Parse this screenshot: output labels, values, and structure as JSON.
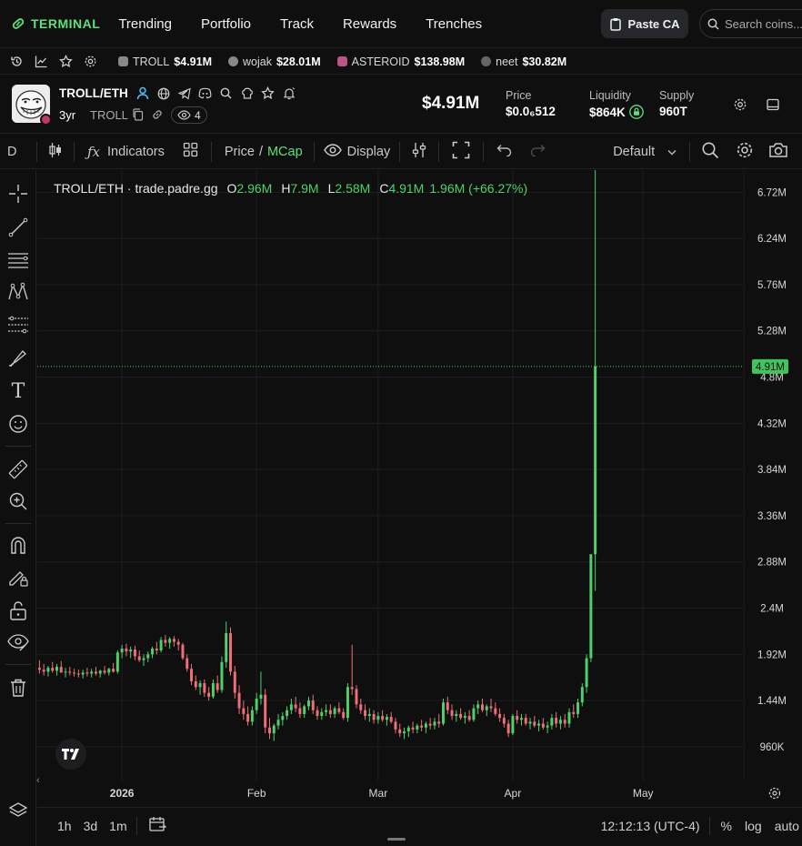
{
  "brand": {
    "name": "TERMINAL"
  },
  "nav": [
    "Trending",
    "Portfolio",
    "Track",
    "Rewards",
    "Trenches"
  ],
  "paste_ca": "Paste CA",
  "search": {
    "placeholder": "Search coins..."
  },
  "tickers": [
    {
      "name": "TROLL",
      "value": "$4.91M"
    },
    {
      "name": "wojak",
      "value": "$28.01M"
    },
    {
      "name": "ASTEROID",
      "value": "$138.98M"
    },
    {
      "name": "neet",
      "value": "$30.82M"
    }
  ],
  "token": {
    "pair": "TROLL/ETH",
    "age": "3yr",
    "symbol": "TROLL",
    "watchers": "4",
    "mcap": "$4.91M",
    "price_label": "Price",
    "price_value": "$0.0₆512",
    "liquidity_label": "Liquidity",
    "liquidity_value": "$864K",
    "supply_label": "Supply",
    "supply_value": "960T"
  },
  "toolbar": {
    "interval": "D",
    "indicators": "Indicators",
    "price": "Price",
    "slash": "/",
    "mcap": "MCap",
    "display": "Display",
    "layout": "Default"
  },
  "legend": {
    "title": "TROLL/ETH · trade.padre.gg",
    "o_label": "O",
    "o": "2.96M",
    "h_label": "H",
    "h": "7.9M",
    "l_label": "L",
    "l": "2.58M",
    "c_label": "C",
    "c": "4.91M",
    "change": "1.96M (+66.27%)"
  },
  "bottom": {
    "ranges": [
      "1h",
      "3d",
      "1m"
    ],
    "time": "12:12:13 (UTC-4)",
    "percent": "%",
    "log": "log",
    "auto": "auto"
  },
  "colors": {
    "up": "#4fd16a",
    "down": "#ef6e78",
    "accent": "#5ee07a"
  },
  "chart_data": {
    "type": "candlestick",
    "y_ticks": [
      "6.72M",
      "6.24M",
      "5.76M",
      "5.28M",
      "4.8M",
      "4.32M",
      "3.84M",
      "3.36M",
      "2.88M",
      "2.4M",
      "1.92M",
      "1.44M",
      "960K"
    ],
    "y_tick_values": [
      6.72,
      6.24,
      5.76,
      5.28,
      4.8,
      4.32,
      3.84,
      3.36,
      2.88,
      2.4,
      1.92,
      1.44,
      0.96
    ],
    "x_ticks": [
      "2026",
      "Feb",
      "Mar",
      "Apr",
      "May"
    ],
    "x_tick_days": [
      0,
      31,
      59,
      90,
      120
    ],
    "ylim": [
      0.6,
      6.95
    ],
    "xlim": [
      -19.5,
      143
    ],
    "last_price_label": "4.91M",
    "last_price": 4.91,
    "candles_millions": [
      [
        -19,
        1.78,
        1.86,
        1.72,
        1.76
      ],
      [
        -18,
        1.76,
        1.82,
        1.7,
        1.74
      ],
      [
        -17,
        1.74,
        1.8,
        1.69,
        1.78
      ],
      [
        -16,
        1.78,
        1.84,
        1.73,
        1.75
      ],
      [
        -15,
        1.75,
        1.82,
        1.7,
        1.79
      ],
      [
        -14,
        1.79,
        1.85,
        1.74,
        1.73
      ],
      [
        -13,
        1.73,
        1.78,
        1.68,
        1.74
      ],
      [
        -12,
        1.74,
        1.79,
        1.7,
        1.73
      ],
      [
        -11,
        1.73,
        1.77,
        1.69,
        1.72
      ],
      [
        -10,
        1.72,
        1.76,
        1.68,
        1.71
      ],
      [
        -9,
        1.71,
        1.76,
        1.67,
        1.73
      ],
      [
        -8,
        1.73,
        1.78,
        1.69,
        1.72
      ],
      [
        -7,
        1.72,
        1.77,
        1.68,
        1.74
      ],
      [
        -6,
        1.74,
        1.79,
        1.7,
        1.72
      ],
      [
        -5,
        1.72,
        1.76,
        1.68,
        1.75
      ],
      [
        -4,
        1.75,
        1.8,
        1.71,
        1.73
      ],
      [
        -3,
        1.73,
        1.78,
        1.7,
        1.77
      ],
      [
        -2,
        1.77,
        1.83,
        1.73,
        1.74
      ],
      [
        -1,
        1.74,
        1.96,
        1.72,
        1.94
      ],
      [
        0,
        1.94,
        2.02,
        1.88,
        1.98
      ],
      [
        1,
        1.98,
        2.03,
        1.9,
        1.95
      ],
      [
        2,
        1.95,
        2.0,
        1.88,
        1.97
      ],
      [
        3,
        1.97,
        2.01,
        1.86,
        1.9
      ],
      [
        4,
        1.9,
        1.96,
        1.84,
        1.86
      ],
      [
        5,
        1.86,
        1.92,
        1.8,
        1.88
      ],
      [
        6,
        1.88,
        1.95,
        1.84,
        1.92
      ],
      [
        7,
        1.92,
        2.0,
        1.88,
        1.98
      ],
      [
        8,
        1.98,
        2.05,
        1.92,
        1.96
      ],
      [
        9,
        1.96,
        2.1,
        1.94,
        2.07
      ],
      [
        10,
        2.07,
        2.12,
        2.0,
        2.04
      ],
      [
        11,
        2.04,
        2.1,
        1.98,
        2.08
      ],
      [
        12,
        2.08,
        2.11,
        2.0,
        2.05
      ],
      [
        13,
        2.05,
        2.08,
        1.96,
        2.02
      ],
      [
        14,
        2.02,
        2.04,
        1.86,
        1.88
      ],
      [
        15,
        1.88,
        1.92,
        1.74,
        1.77
      ],
      [
        16,
        1.77,
        1.82,
        1.6,
        1.64
      ],
      [
        17,
        1.64,
        1.7,
        1.55,
        1.58
      ],
      [
        18,
        1.58,
        1.65,
        1.5,
        1.62
      ],
      [
        19,
        1.62,
        1.66,
        1.48,
        1.52
      ],
      [
        20,
        1.52,
        1.58,
        1.44,
        1.48
      ],
      [
        21,
        1.48,
        1.66,
        1.46,
        1.62
      ],
      [
        22,
        1.62,
        1.7,
        1.52,
        1.55
      ],
      [
        23,
        1.55,
        1.9,
        1.52,
        1.84
      ],
      [
        24,
        1.84,
        2.26,
        1.78,
        2.14
      ],
      [
        25,
        2.14,
        2.2,
        1.7,
        1.74
      ],
      [
        26,
        1.74,
        1.8,
        1.46,
        1.52
      ],
      [
        27,
        1.52,
        1.6,
        1.3,
        1.36
      ],
      [
        28,
        1.36,
        1.44,
        1.24,
        1.3
      ],
      [
        29,
        1.3,
        1.38,
        1.18,
        1.22
      ],
      [
        30,
        1.22,
        1.38,
        1.18,
        1.34
      ],
      [
        31,
        1.34,
        1.52,
        1.3,
        1.46
      ],
      [
        32,
        1.46,
        1.74,
        1.4,
        1.5
      ],
      [
        33,
        1.5,
        1.56,
        1.1,
        1.16
      ],
      [
        34,
        1.16,
        1.26,
        1.04,
        1.1
      ],
      [
        35,
        1.1,
        1.2,
        1.02,
        1.18
      ],
      [
        36,
        1.18,
        1.3,
        1.14,
        1.24
      ],
      [
        37,
        1.24,
        1.32,
        1.18,
        1.28
      ],
      [
        38,
        1.28,
        1.38,
        1.24,
        1.34
      ],
      [
        39,
        1.34,
        1.46,
        1.3,
        1.4
      ],
      [
        40,
        1.4,
        1.48,
        1.32,
        1.36
      ],
      [
        41,
        1.36,
        1.42,
        1.26,
        1.3
      ],
      [
        42,
        1.3,
        1.4,
        1.26,
        1.38
      ],
      [
        43,
        1.38,
        1.48,
        1.34,
        1.44
      ],
      [
        44,
        1.44,
        1.5,
        1.3,
        1.34
      ],
      [
        45,
        1.34,
        1.38,
        1.24,
        1.28
      ],
      [
        46,
        1.28,
        1.36,
        1.24,
        1.32
      ],
      [
        47,
        1.32,
        1.4,
        1.28,
        1.34
      ],
      [
        48,
        1.34,
        1.4,
        1.26,
        1.3
      ],
      [
        49,
        1.3,
        1.38,
        1.26,
        1.36
      ],
      [
        50,
        1.36,
        1.42,
        1.3,
        1.32
      ],
      [
        51,
        1.32,
        1.36,
        1.24,
        1.26
      ],
      [
        52,
        1.26,
        1.62,
        1.22,
        1.58
      ],
      [
        53,
        1.58,
        2.02,
        1.5,
        1.56
      ],
      [
        54,
        1.56,
        1.6,
        1.36,
        1.4
      ],
      [
        55,
        1.4,
        1.46,
        1.3,
        1.34
      ],
      [
        56,
        1.34,
        1.4,
        1.24,
        1.28
      ],
      [
        57,
        1.28,
        1.36,
        1.22,
        1.3
      ],
      [
        58,
        1.3,
        1.34,
        1.2,
        1.24
      ],
      [
        59,
        1.24,
        1.32,
        1.2,
        1.28
      ],
      [
        60,
        1.28,
        1.34,
        1.22,
        1.24
      ],
      [
        61,
        1.24,
        1.3,
        1.18,
        1.27
      ],
      [
        62,
        1.27,
        1.32,
        1.2,
        1.22
      ],
      [
        63,
        1.22,
        1.26,
        1.1,
        1.14
      ],
      [
        64,
        1.14,
        1.2,
        1.06,
        1.1
      ],
      [
        65,
        1.1,
        1.16,
        1.04,
        1.12
      ],
      [
        66,
        1.12,
        1.18,
        1.06,
        1.16
      ],
      [
        67,
        1.16,
        1.22,
        1.1,
        1.14
      ],
      [
        68,
        1.14,
        1.2,
        1.1,
        1.18
      ],
      [
        69,
        1.18,
        1.24,
        1.12,
        1.16
      ],
      [
        70,
        1.16,
        1.22,
        1.1,
        1.2
      ],
      [
        71,
        1.2,
        1.26,
        1.14,
        1.18
      ],
      [
        72,
        1.18,
        1.26,
        1.14,
        1.22
      ],
      [
        73,
        1.22,
        1.3,
        1.16,
        1.2
      ],
      [
        74,
        1.2,
        1.46,
        1.18,
        1.42
      ],
      [
        75,
        1.42,
        1.48,
        1.3,
        1.34
      ],
      [
        76,
        1.34,
        1.4,
        1.24,
        1.28
      ],
      [
        77,
        1.28,
        1.34,
        1.22,
        1.3
      ],
      [
        78,
        1.3,
        1.36,
        1.24,
        1.26
      ],
      [
        79,
        1.26,
        1.32,
        1.2,
        1.28
      ],
      [
        80,
        1.28,
        1.34,
        1.22,
        1.24
      ],
      [
        81,
        1.24,
        1.4,
        1.22,
        1.36
      ],
      [
        82,
        1.36,
        1.44,
        1.3,
        1.4
      ],
      [
        83,
        1.4,
        1.46,
        1.32,
        1.34
      ],
      [
        84,
        1.34,
        1.4,
        1.28,
        1.38
      ],
      [
        85,
        1.38,
        1.46,
        1.32,
        1.36
      ],
      [
        86,
        1.36,
        1.42,
        1.28,
        1.3
      ],
      [
        87,
        1.3,
        1.36,
        1.22,
        1.26
      ],
      [
        88,
        1.26,
        1.3,
        1.16,
        1.2
      ],
      [
        89,
        1.2,
        1.24,
        1.06,
        1.1
      ],
      [
        90,
        1.1,
        1.3,
        1.08,
        1.28
      ],
      [
        91,
        1.28,
        1.34,
        1.2,
        1.24
      ],
      [
        92,
        1.24,
        1.3,
        1.18,
        1.26
      ],
      [
        93,
        1.26,
        1.3,
        1.18,
        1.2
      ],
      [
        94,
        1.2,
        1.26,
        1.14,
        1.22
      ],
      [
        95,
        1.22,
        1.28,
        1.16,
        1.18
      ],
      [
        96,
        1.18,
        1.24,
        1.12,
        1.2
      ],
      [
        97,
        1.2,
        1.26,
        1.14,
        1.16
      ],
      [
        98,
        1.16,
        1.22,
        1.1,
        1.18
      ],
      [
        99,
        1.18,
        1.3,
        1.14,
        1.26
      ],
      [
        100,
        1.26,
        1.32,
        1.16,
        1.2
      ],
      [
        101,
        1.2,
        1.28,
        1.14,
        1.24
      ],
      [
        102,
        1.24,
        1.3,
        1.16,
        1.2
      ],
      [
        103,
        1.2,
        1.36,
        1.16,
        1.32
      ],
      [
        104,
        1.32,
        1.4,
        1.26,
        1.3
      ],
      [
        105,
        1.3,
        1.46,
        1.26,
        1.42
      ],
      [
        106,
        1.42,
        1.62,
        1.38,
        1.58
      ],
      [
        107,
        1.58,
        1.92,
        1.52,
        1.88
      ],
      [
        108,
        1.88,
        2.96,
        1.84,
        2.96
      ],
      [
        109,
        2.96,
        7.9,
        2.58,
        4.91
      ]
    ]
  }
}
